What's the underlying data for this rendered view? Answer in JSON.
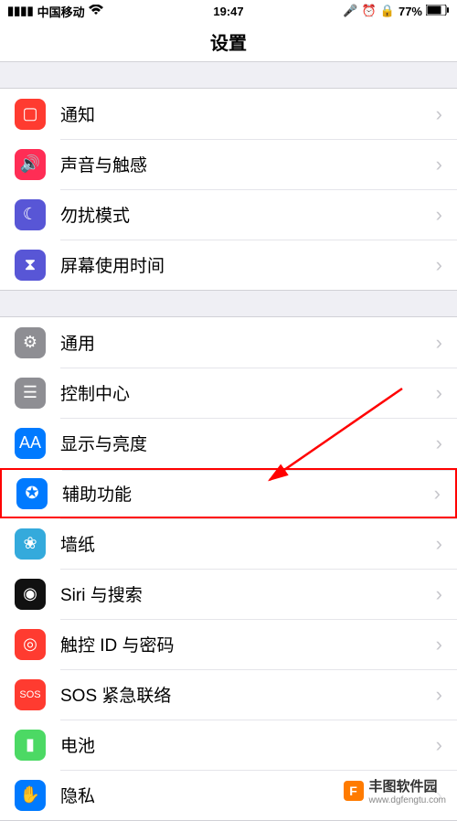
{
  "status": {
    "carrier": "中国移动",
    "time": "19:47",
    "battery": "77%"
  },
  "header": {
    "title": "设置"
  },
  "group1": [
    {
      "name": "notifications",
      "label": "通知",
      "icon": "notifications-icon",
      "cls": "ic-notify",
      "glyph": "▢"
    },
    {
      "name": "sounds",
      "label": "声音与触感",
      "icon": "sound-icon",
      "cls": "ic-sound",
      "glyph": "🔊"
    },
    {
      "name": "dnd",
      "label": "勿扰模式",
      "icon": "moon-icon",
      "cls": "ic-dnd",
      "glyph": "☾"
    },
    {
      "name": "screentime",
      "label": "屏幕使用时间",
      "icon": "hourglass-icon",
      "cls": "ic-screen",
      "glyph": "⧗"
    }
  ],
  "group2": [
    {
      "name": "general",
      "label": "通用",
      "icon": "gear-icon",
      "cls": "ic-general",
      "glyph": "⚙"
    },
    {
      "name": "control",
      "label": "控制中心",
      "icon": "switches-icon",
      "cls": "ic-control",
      "glyph": "☰"
    },
    {
      "name": "display",
      "label": "显示与亮度",
      "icon": "text-size-icon",
      "cls": "ic-display",
      "glyph": "AA"
    },
    {
      "name": "accessibility",
      "label": "辅助功能",
      "icon": "accessibility-icon",
      "cls": "ic-access",
      "glyph": "✪",
      "highlight": true
    },
    {
      "name": "wallpaper",
      "label": "墙纸",
      "icon": "flower-icon",
      "cls": "ic-wall",
      "glyph": "❀"
    },
    {
      "name": "siri",
      "label": "Siri 与搜索",
      "icon": "siri-icon",
      "cls": "ic-siri",
      "glyph": "◉"
    },
    {
      "name": "touchid",
      "label": "触控 ID 与密码",
      "icon": "fingerprint-icon",
      "cls": "ic-touch",
      "glyph": "◎"
    },
    {
      "name": "sos",
      "label": "SOS 紧急联络",
      "icon": "sos-icon",
      "cls": "ic-sos",
      "glyph": "SOS"
    },
    {
      "name": "battery",
      "label": "电池",
      "icon": "battery-icon",
      "cls": "ic-batt",
      "glyph": "▮"
    },
    {
      "name": "privacy",
      "label": "隐私",
      "icon": "hand-icon",
      "cls": "ic-priv",
      "glyph": "✋"
    }
  ],
  "watermark": {
    "brand": "丰图软件园",
    "url": "www.dgfengtu.com",
    "logo": "F"
  }
}
